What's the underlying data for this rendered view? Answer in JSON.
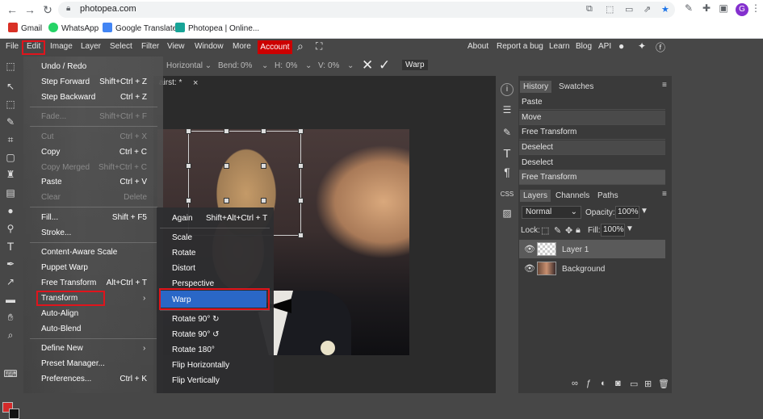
{
  "browser": {
    "url": "photopea.com",
    "bookmarks": [
      {
        "label": "Gmail",
        "icon": "gmail-icon",
        "color": "#d93025"
      },
      {
        "label": "WhatsApp",
        "icon": "whatsapp-icon",
        "color": "#25d366"
      },
      {
        "label": "Google Translate",
        "icon": "translate-icon",
        "color": "#4285f4"
      },
      {
        "label": "Photopea | Online...",
        "icon": "photopea-icon",
        "color": "#18a497"
      }
    ],
    "avatar_letter": "G"
  },
  "menubar": {
    "items": [
      "File",
      "Edit",
      "Image",
      "Layer",
      "Select",
      "Filter",
      "View",
      "Window",
      "More"
    ],
    "account": "Account",
    "right": [
      "About",
      "Report a bug",
      "Learn",
      "Blog",
      "API"
    ]
  },
  "options": {
    "mode": "Horizontal",
    "bend_label": "Bend:",
    "bend_value": "0%",
    "h_label": "H:",
    "h_value": "0%",
    "v_label": "V:",
    "v_value": "0%",
    "warp_button": "Warp"
  },
  "doc_tab": {
    "name": "airst: *",
    "close": "×"
  },
  "edit_menu": [
    {
      "label": "Undo / Redo",
      "shortcut": "",
      "disabled": false
    },
    {
      "label": "Step Forward",
      "shortcut": "Shift+Ctrl + Z",
      "disabled": false
    },
    {
      "label": "Step Backward",
      "shortcut": "Ctrl + Z",
      "disabled": false
    },
    {
      "label": "Fade...",
      "shortcut": "Shift+Ctrl + F",
      "disabled": true
    },
    {
      "label": "Cut",
      "shortcut": "Ctrl + X",
      "disabled": true
    },
    {
      "label": "Copy",
      "shortcut": "Ctrl + C",
      "disabled": false
    },
    {
      "label": "Copy Merged",
      "shortcut": "Shift+Ctrl + C",
      "disabled": true
    },
    {
      "label": "Paste",
      "shortcut": "Ctrl + V",
      "disabled": false
    },
    {
      "label": "Clear",
      "shortcut": "Delete",
      "disabled": true
    },
    {
      "label": "Fill...",
      "shortcut": "Shift + F5",
      "disabled": false
    },
    {
      "label": "Stroke...",
      "shortcut": "",
      "disabled": false
    },
    {
      "label": "Content-Aware Scale",
      "shortcut": "",
      "disabled": false
    },
    {
      "label": "Puppet Warp",
      "shortcut": "",
      "disabled": false
    },
    {
      "label": "Free Transform",
      "shortcut": "Alt+Ctrl + T",
      "disabled": false
    },
    {
      "label": "Transform",
      "shortcut": "",
      "disabled": false
    },
    {
      "label": "Auto-Align",
      "shortcut": "",
      "disabled": false
    },
    {
      "label": "Auto-Blend",
      "shortcut": "",
      "disabled": false
    },
    {
      "label": "Define New",
      "shortcut": "",
      "disabled": false
    },
    {
      "label": "Preset Manager...",
      "shortcut": "",
      "disabled": false
    },
    {
      "label": "Preferences...",
      "shortcut": "Ctrl + K",
      "disabled": false
    }
  ],
  "transform_submenu": [
    {
      "label": "Again",
      "shortcut": "Shift+Alt+Ctrl + T"
    },
    {
      "label": "Scale",
      "shortcut": ""
    },
    {
      "label": "Rotate",
      "shortcut": ""
    },
    {
      "label": "Distort",
      "shortcut": ""
    },
    {
      "label": "Perspective",
      "shortcut": ""
    },
    {
      "label": "Warp",
      "shortcut": ""
    },
    {
      "label": "Rotate 90° ↻",
      "shortcut": ""
    },
    {
      "label": "Rotate 90° ↺",
      "shortcut": ""
    },
    {
      "label": "Rotate 180°",
      "shortcut": ""
    },
    {
      "label": "Flip Horizontally",
      "shortcut": ""
    },
    {
      "label": "Flip Vertically",
      "shortcut": ""
    }
  ],
  "history_panel": {
    "tabs": [
      "History",
      "Swatches"
    ],
    "items": [
      "Paste",
      "Move",
      "Free Transform",
      "Deselect",
      "Deselect",
      "Free Transform"
    ]
  },
  "layers_panel": {
    "tabs": [
      "Layers",
      "Channels",
      "Paths"
    ],
    "blend_mode": "Normal",
    "opacity_label": "Opacity:",
    "opacity_value": "100%",
    "lock_label": "Lock:",
    "fill_label": "Fill:",
    "fill_value": "100%",
    "layers": [
      "Layer 1",
      "Background"
    ]
  },
  "colors": {
    "accent_red": "#e0141c",
    "selected_blue": "#2a67c6",
    "foreground": "#d42a2a",
    "background": "#111111"
  }
}
